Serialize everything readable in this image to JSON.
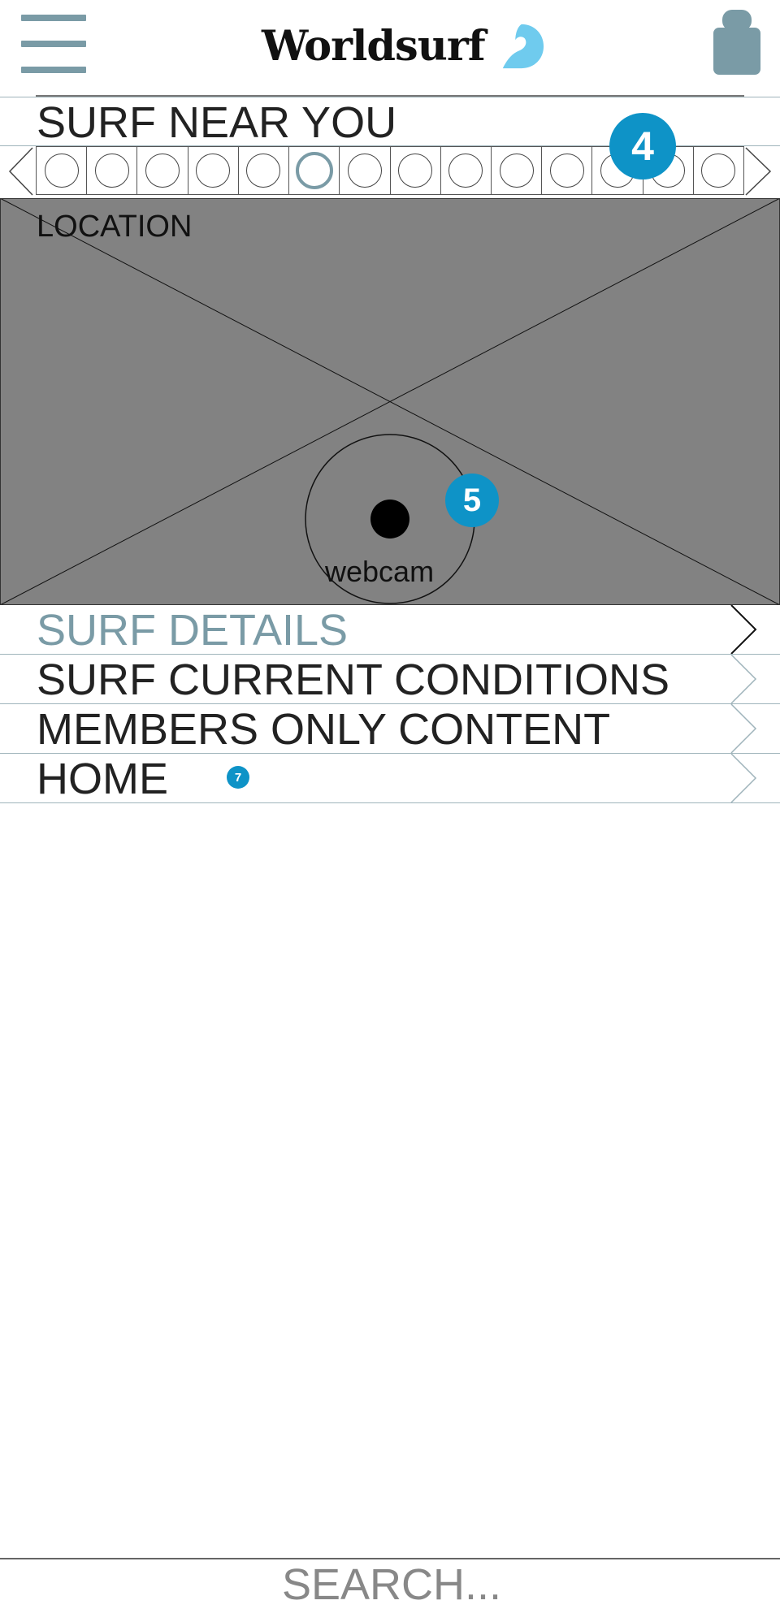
{
  "header": {
    "logo_text": "Worldsurf",
    "menu_icon": "hamburger-menu-icon",
    "user_icon": "user-profile-icon",
    "logo_icon": "wave-icon",
    "accent_color": "#7a9ba6",
    "brand_color": "#6fcbee"
  },
  "surf_near_you": {
    "title": "SURF NEAR YOU",
    "carousel": {
      "slide_count": 14,
      "active_index": 5,
      "prev_icon": "chevron-left-icon",
      "next_icon": "chevron-right-icon"
    }
  },
  "media": {
    "location_label": "LOCATION",
    "webcam_label": "webcam",
    "background_color": "#828282"
  },
  "annotations": {
    "badge_4": "4",
    "badge_5": "5",
    "badge_7": "7",
    "badge_color": "#0e93c7"
  },
  "menu_list": {
    "items": [
      {
        "label": "SURF DETAILS",
        "active": true
      },
      {
        "label": "SURF CURRENT CONDITIONS",
        "active": false
      },
      {
        "label": "MEMBERS ONLY CONTENT",
        "active": false
      },
      {
        "label": "HOME",
        "active": false
      }
    ]
  },
  "search": {
    "placeholder": "SEARCH..."
  }
}
